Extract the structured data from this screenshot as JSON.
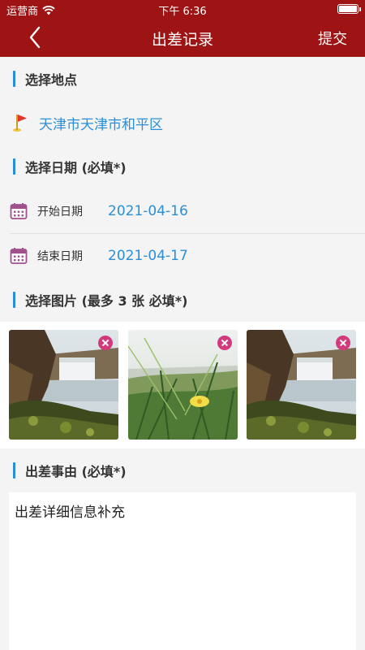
{
  "status_bar": {
    "carrier": "运营商",
    "time": "下午 6:36",
    "battery_level": 1.0
  },
  "nav": {
    "title": "出差记录",
    "submit_label": "提交"
  },
  "location": {
    "section_title": "选择地点",
    "value": "天津市天津市和平区"
  },
  "dates": {
    "section_title": "选择日期 (必填*)",
    "start_label": "开始日期",
    "start_value": "2021-04-16",
    "end_label": "结束日期",
    "end_value": "2021-04-17"
  },
  "photos": {
    "section_title": "选择图片 (最多 3 张 必填*)",
    "count": 3
  },
  "reason": {
    "section_title": "出差事由 (必填*)",
    "value": "出差详细信息补充"
  },
  "colors": {
    "header": "#9e1414",
    "accent": "#2a8fd6",
    "remove_badge": "#d23a7c"
  }
}
